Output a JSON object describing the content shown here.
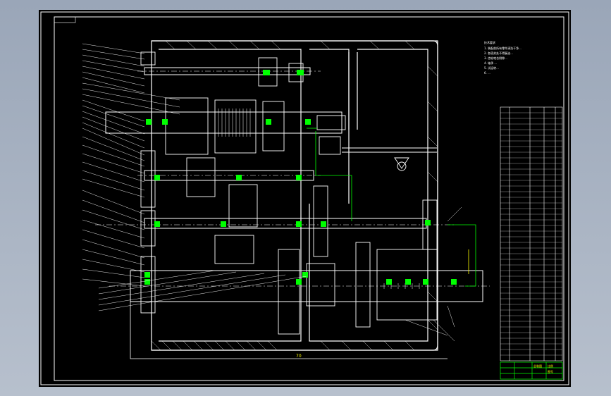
{
  "drawing": {
    "title_box_text": "",
    "dimension_label": "70",
    "notes_heading": "技术要求",
    "notes": [
      "1. 装配前所有零件清洗干净...",
      "2. 各密封处不得漏油...",
      "3. 齿轮啮合侧隙...",
      "4. 轴承 ...",
      "5. 试运转...",
      "6. ..."
    ],
    "title_block": {
      "name": "总装图",
      "label_a": "比例",
      "label_b": "图号"
    }
  },
  "colors": {
    "line": "#ffffff",
    "accent_green": "#00ff00",
    "accent_yellow": "#ffff00",
    "background": "#000000"
  }
}
